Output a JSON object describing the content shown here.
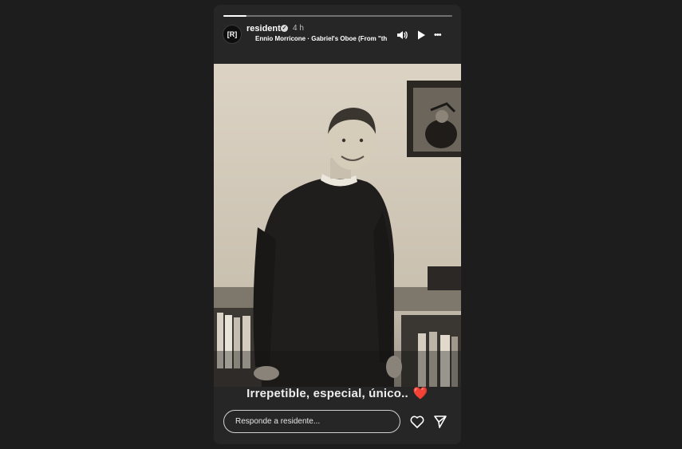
{
  "story": {
    "username": "residente",
    "avatar_text": "[R]",
    "verified_glyph": "✓",
    "time": "4 h",
    "music": {
      "artist": "Ennio Morricone",
      "separator": " · ",
      "track": "Gabriel's Oboe (From \"th"
    },
    "progress": 0.1,
    "controls": [
      "volume-icon",
      "play-icon",
      "more-options-icon"
    ],
    "more_glyph": "•••"
  },
  "caption": {
    "text": "Irrepetible, especial, único..",
    "emoji": "❤️"
  },
  "reply": {
    "placeholder": "Responde a residente..."
  },
  "icons": {
    "like": "heart-outline-icon",
    "share": "send-icon"
  }
}
